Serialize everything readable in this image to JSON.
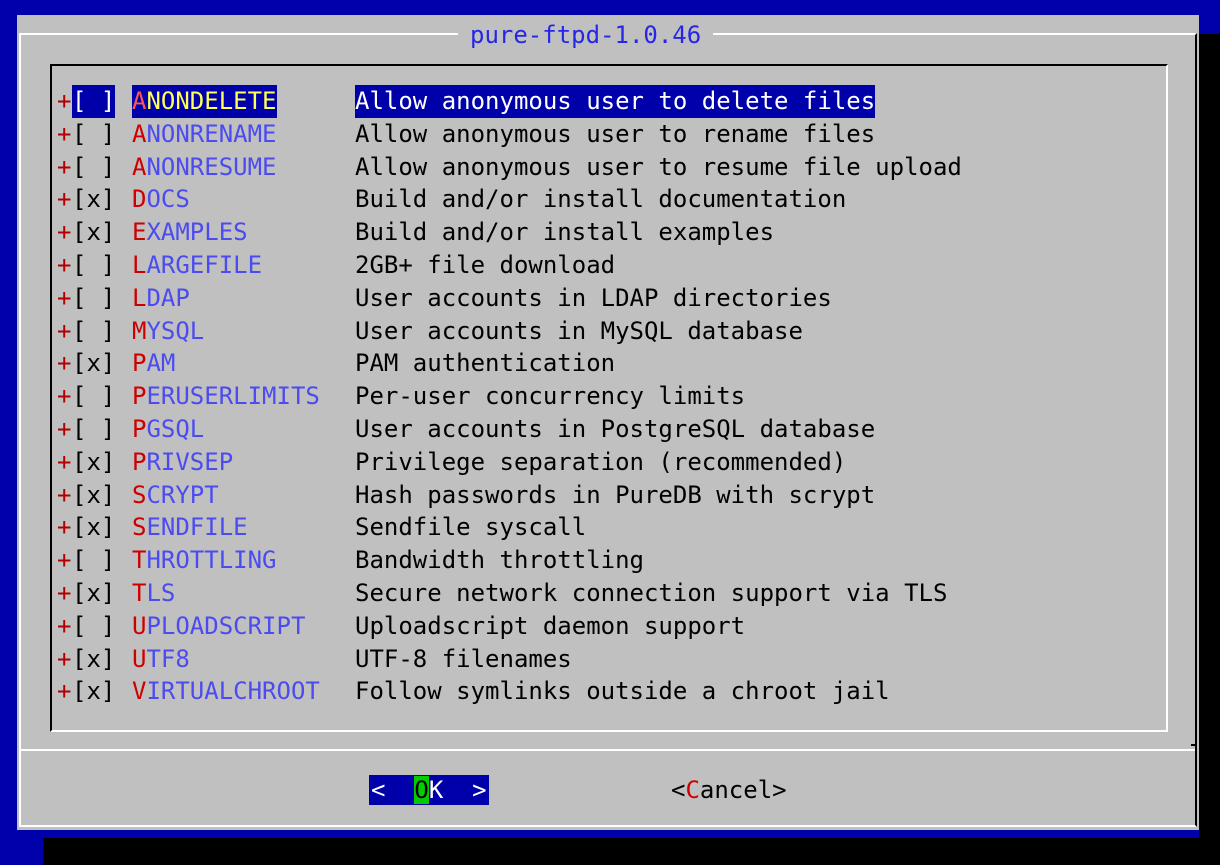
{
  "dialog": {
    "title": "pure-ftpd-1.0.46"
  },
  "options": [
    {
      "mark": "+",
      "check": "[ ]",
      "hot": "A",
      "rest": "NONDELETE",
      "desc": "Allow anonymous user to delete files"
    },
    {
      "mark": "+",
      "check": "[ ]",
      "hot": "A",
      "rest": "NONRENAME",
      "desc": "Allow anonymous user to rename files"
    },
    {
      "mark": "+",
      "check": "[ ]",
      "hot": "A",
      "rest": "NONRESUME",
      "desc": "Allow anonymous user to resume file upload"
    },
    {
      "mark": "+",
      "check": "[x]",
      "hot": "D",
      "rest": "OCS",
      "desc": "Build and/or install documentation"
    },
    {
      "mark": "+",
      "check": "[x]",
      "hot": "E",
      "rest": "XAMPLES",
      "desc": "Build and/or install examples"
    },
    {
      "mark": "+",
      "check": "[ ]",
      "hot": "L",
      "rest": "ARGEFILE",
      "desc": "2GB+ file download"
    },
    {
      "mark": "+",
      "check": "[ ]",
      "hot": "L",
      "rest": "DAP",
      "desc": "User accounts in LDAP directories"
    },
    {
      "mark": "+",
      "check": "[ ]",
      "hot": "M",
      "rest": "YSQL",
      "desc": "User accounts in MySQL database"
    },
    {
      "mark": "+",
      "check": "[x]",
      "hot": "P",
      "rest": "AM",
      "desc": "PAM authentication"
    },
    {
      "mark": "+",
      "check": "[ ]",
      "hot": "P",
      "rest": "ERUSERLIMITS",
      "desc": "Per-user concurrency limits"
    },
    {
      "mark": "+",
      "check": "[ ]",
      "hot": "P",
      "rest": "GSQL",
      "desc": "User accounts in PostgreSQL database"
    },
    {
      "mark": "+",
      "check": "[x]",
      "hot": "P",
      "rest": "RIVSEP",
      "desc": "Privilege separation (recommended)"
    },
    {
      "mark": "+",
      "check": "[x]",
      "hot": "S",
      "rest": "CRYPT",
      "desc": "Hash passwords in PureDB with scrypt"
    },
    {
      "mark": "+",
      "check": "[x]",
      "hot": "S",
      "rest": "ENDFILE",
      "desc": "Sendfile syscall"
    },
    {
      "mark": "+",
      "check": "[ ]",
      "hot": "T",
      "rest": "HROTTLING",
      "desc": "Bandwidth throttling"
    },
    {
      "mark": "+",
      "check": "[x]",
      "hot": "T",
      "rest": "LS",
      "desc": "Secure network connection support via TLS"
    },
    {
      "mark": "+",
      "check": "[ ]",
      "hot": "U",
      "rest": "PLOADSCRIPT",
      "desc": "Uploadscript daemon support"
    },
    {
      "mark": "+",
      "check": "[x]",
      "hot": "U",
      "rest": "TF8",
      "desc": "UTF-8 filenames"
    },
    {
      "mark": "+",
      "check": "[x]",
      "hot": "V",
      "rest": "IRTUALCHROOT",
      "desc": "Follow symlinks outside a chroot jail"
    }
  ],
  "buttons": {
    "ok": {
      "pre": "<  ",
      "hot": "O",
      "post": "K  >"
    },
    "cancel": {
      "pre": "<",
      "hot": "C",
      "post": "ancel>"
    }
  },
  "colors": {
    "screen_bg": "#0000aa",
    "dialog_bg": "#c0c0c0",
    "title": "#2626e8",
    "hotkey": "#cc0000",
    "option_name": "#4b4bf0",
    "selected_bg": "#0000aa",
    "selected_name": "#ffff55",
    "ok_hotkey_bg": "#00cc00"
  }
}
